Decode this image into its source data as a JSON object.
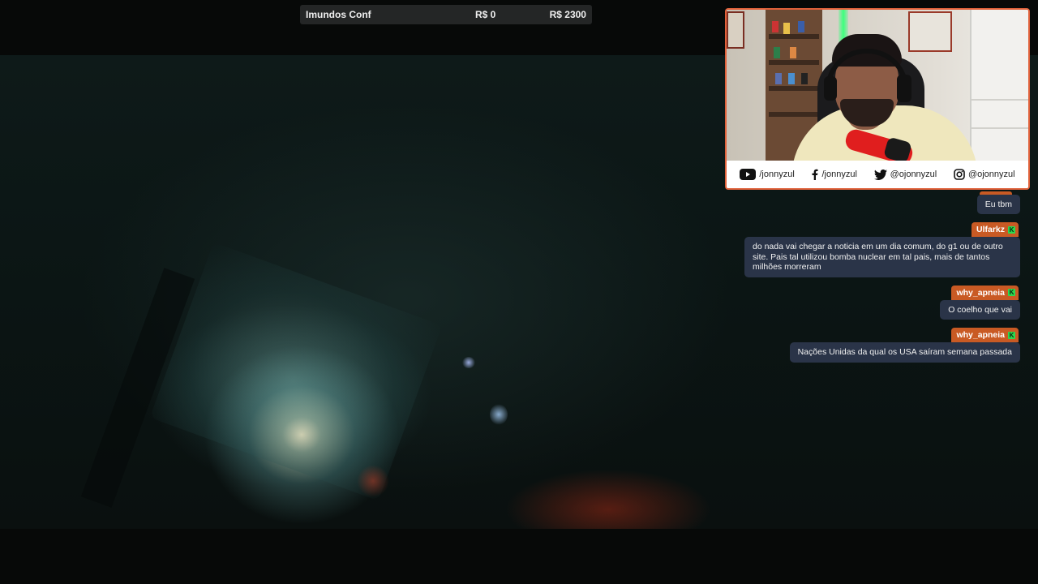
{
  "stats_bar": {
    "team_label": "Imundos Conf",
    "current_amount": "R$ 0",
    "goal_amount": "R$ 2300"
  },
  "webcam": {
    "border_color": "#e0613a",
    "socials": [
      {
        "icon": "youtube-icon",
        "handle": "/jonnyzul"
      },
      {
        "icon": "facebook-icon",
        "handle": "/jonnyzul"
      },
      {
        "icon": "twitter-icon",
        "handle": "@ojonnyzul"
      },
      {
        "icon": "instagram-icon",
        "handle": "@ojonnyzul"
      }
    ]
  },
  "chat": {
    "accent_color": "#c95a24",
    "badge_color": "#2bd84f",
    "messages": [
      {
        "user": "",
        "text": "Eu tbm"
      },
      {
        "user": "Ulfarkz",
        "text": "do nada vai chegar a noticia em um dia comum, do g1 ou de outro site. Pais tal utilizou bomba nuclear em tal pais, mais de tantos milhões morreram"
      },
      {
        "user": "why_apneia",
        "text": "O coelho que vai"
      },
      {
        "user": "why_apneia",
        "text": "Nações Unidas da qual os USA saíram semana passada"
      }
    ]
  }
}
